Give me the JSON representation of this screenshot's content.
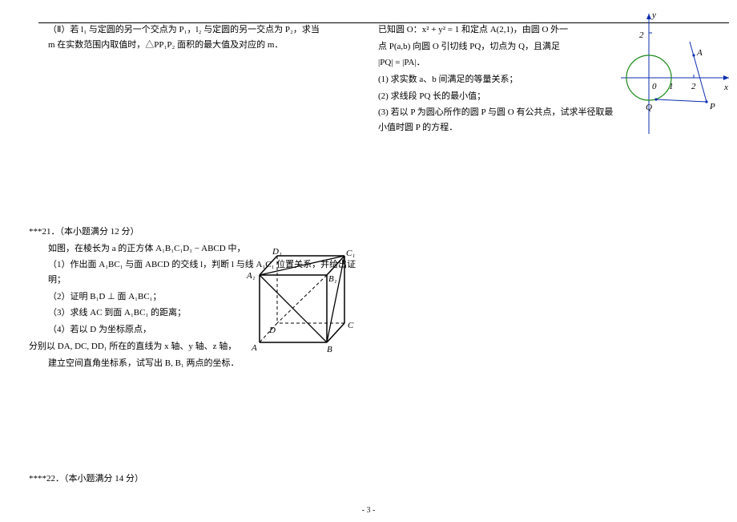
{
  "top_rule": true,
  "q2_part2": "（Ⅱ）若 l₁ 与定圆的另一个交点为 P₁，l₂ 与定圆的另一交点为 P₂，求当 m 在实数范围内取值时，△PP₁P₂ 面积的最大值及对应的 m．",
  "q21": {
    "header": "***21．（本小题满分 12 分）",
    "stem1": "如图，在棱长为 a 的正方体 A₁B₁C₁D₁ − ABCD 中，",
    "p1": "（1）作出面 A₁BC₁ 与面 ABCD 的交线 l，判断 l 与线 A₁C₁ 位置关系，并给出证明；",
    "p2": "（2）证明 B₁D ⊥ 面 A₁BC₁；",
    "p3": "（3）求线 AC 到面 A₁BC₁ 的距离；",
    "p4": "（4）若以 D 为坐标原点，",
    "tail1": "分别以 DA, DC, DD₁ 所在的直线为 x 轴、y 轴、z 轴，",
    "tail2": "建立空间直角坐标系，试写出 B, B₁ 两点的坐标．"
  },
  "q22": {
    "header": "****22．（本小题满分 14 分）",
    "stem_a": "已知圆 O：x² + y² = 1 和定点 A(2,1)，由圆 O 外一",
    "stem_b": "点 P(a,b) 向圆 O 引切线 PQ，切点为 Q，且满足",
    "cond": "|PQ| = |PA|．",
    "p1": "(1) 求实数 a、b 间满足的等量关系；",
    "p2": "(2) 求线段 PQ 长的最小值；",
    "p3": "(3) 若以 P 为圆心所作的圆 P 与圆 O 有公共点，试求半径取最小值时圆 P 的方程．"
  },
  "cube_labels": {
    "D1": "D₁",
    "C1": "C₁",
    "A1": "A₁",
    "B1": "B₁",
    "D": "D",
    "C": "C",
    "A": "A",
    "B": "B"
  },
  "graph": {
    "y_label": "y",
    "x_label": "x",
    "origin": "0",
    "one": "1",
    "two": "2",
    "A": "A",
    "P": "P",
    "Q": "Q"
  },
  "chart_data": {
    "type": "scatter",
    "title": "",
    "xlabel": "x",
    "ylabel": "y",
    "xlim": [
      -1.5,
      3.5
    ],
    "ylim": [
      -1.5,
      2.5
    ],
    "series": [
      {
        "name": "circle O (unit circle)",
        "center": [
          0,
          0
        ],
        "radius": 1
      },
      {
        "name": "A",
        "x": 2,
        "y": 1
      },
      {
        "name": "P",
        "x": 2.5,
        "y": -1
      },
      {
        "name": "Q",
        "x": 0.3,
        "y": -0.95
      }
    ],
    "segments": [
      {
        "from": "P",
        "to": "A"
      },
      {
        "from": "P",
        "to": "Q"
      }
    ],
    "ticks_x": [
      1,
      2
    ],
    "ticks_y": [
      2
    ]
  },
  "footer": "- 3 -"
}
